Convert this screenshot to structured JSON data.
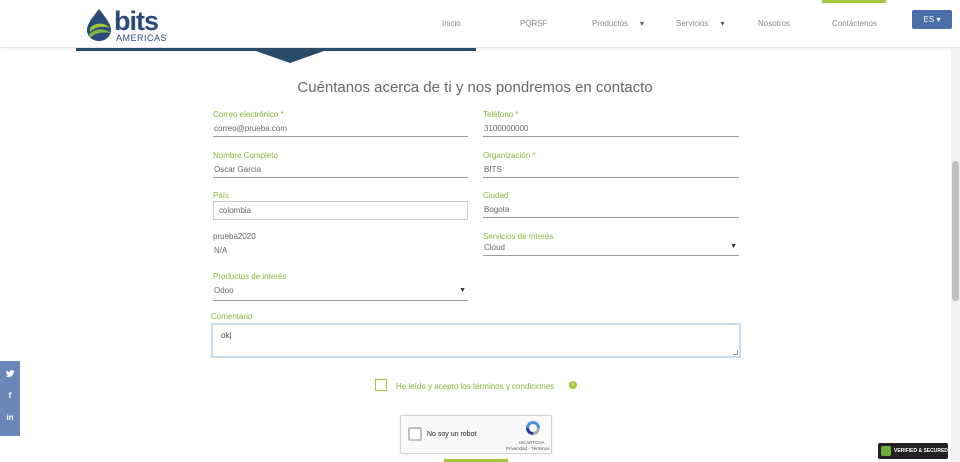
{
  "header": {
    "logo_text": "bits",
    "logo_sub": "AMERICAS",
    "nav": [
      {
        "label": "Inicio",
        "dropdown": false
      },
      {
        "label": "PQRSF",
        "dropdown": false
      },
      {
        "label": "Productos",
        "dropdown": true
      },
      {
        "label": "Servicios",
        "dropdown": true
      },
      {
        "label": "Nosotros",
        "dropdown": false
      },
      {
        "label": "Contáctenos",
        "dropdown": false,
        "active": true
      }
    ],
    "lang": "ES"
  },
  "form": {
    "title": "Cuéntanos acerca de ti y nos pondremos en contacto",
    "email": {
      "label": "Correo electrónico *",
      "value": "correo@prueba.com"
    },
    "phone": {
      "label": "Teléfono *",
      "value": "3100000000"
    },
    "name": {
      "label": "Nombre Completo",
      "value": "Oscar Garcia"
    },
    "org": {
      "label": "Organización *",
      "value": "BITS"
    },
    "country": {
      "label": "País",
      "value": "colombia"
    },
    "city": {
      "label": "Ciudad",
      "value": "Bogota"
    },
    "custom": {
      "label": "prueba2020",
      "value": "N/A"
    },
    "services": {
      "label": "Servicios de Interés",
      "value": "Cloud"
    },
    "products": {
      "label": "Productos de interés",
      "value": "Odoo"
    },
    "comment": {
      "label": "Comentario",
      "value": "ok"
    },
    "terms_prefix": "He leído y acepto los ",
    "terms_link": "términos y condiciones"
  },
  "recaptcha": {
    "label": "No soy un robot",
    "brand": "reCAPTCHA",
    "links": "Privacidad - Términos"
  },
  "social": [
    "twitter-icon",
    "facebook-icon",
    "linkedin-icon"
  ],
  "badge": {
    "text": "VERIFIED & SECURED"
  },
  "colors": {
    "accent": "#a4c639",
    "brand": "#2a4a7a",
    "lang_button": "#4a6ea8"
  }
}
